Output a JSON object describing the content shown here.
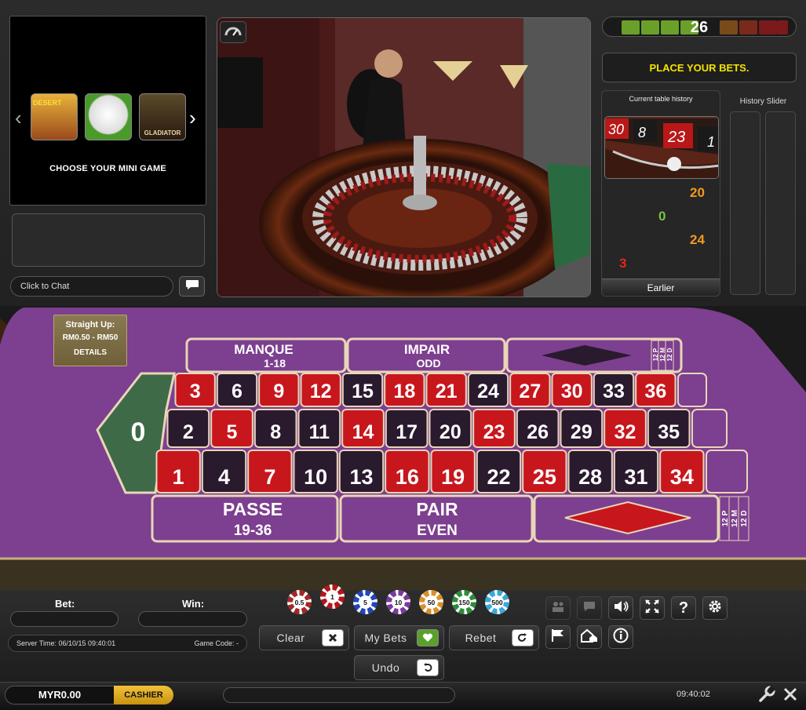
{
  "mini_game": {
    "caption": "CHOOSE YOUR MINI GAME",
    "thumbs": [
      {
        "name": "desert-treasure-thumb",
        "label": "DESERT"
      },
      {
        "name": "football-thumb",
        "label": ""
      },
      {
        "name": "gladiator-thumb",
        "label": "GLADIATOR"
      }
    ]
  },
  "chat": {
    "placeholder": "Click to Chat"
  },
  "timer": {
    "value": "26"
  },
  "status": {
    "message": "PLACE YOUR BETS."
  },
  "history": {
    "title": "Current table history",
    "wheel_numbers": [
      "30",
      "8",
      "23",
      "1"
    ],
    "results": [
      {
        "value": "20",
        "color": "#f39a1e"
      },
      {
        "value": "0",
        "color": "#7bc142"
      },
      {
        "value": "24",
        "color": "#f39a1e"
      },
      {
        "value": "3",
        "color": "#e8261a"
      }
    ],
    "earlier_label": "Earlier"
  },
  "slider": {
    "title": "History Slider"
  },
  "limits": {
    "title": "Straight Up:",
    "range": "RM0.50 - RM50",
    "details": "DETAILS"
  },
  "table": {
    "zero": "0",
    "manque": "MANQUE",
    "manque_range": "1-18",
    "impair": "IMPAIR",
    "impair_en": "ODD",
    "passe": "PASSE",
    "passe_range": "19-36",
    "pair": "PAIR",
    "pair_en": "EVEN",
    "dozen_top": [
      "12 P",
      "12 M",
      "12 D"
    ],
    "dozen_bottom": [
      "12 P",
      "12 M",
      "12 D"
    ],
    "colors": {
      "felt": "#7d3f8f",
      "red": "#c8161d",
      "black": "#2a1a2e",
      "green": "#3e6a48"
    },
    "rows": [
      [
        {
          "n": "3",
          "c": "red"
        },
        {
          "n": "6",
          "c": "black"
        },
        {
          "n": "9",
          "c": "red"
        },
        {
          "n": "12",
          "c": "red"
        },
        {
          "n": "15",
          "c": "black"
        },
        {
          "n": "18",
          "c": "red"
        },
        {
          "n": "21",
          "c": "red"
        },
        {
          "n": "24",
          "c": "black"
        },
        {
          "n": "27",
          "c": "red"
        },
        {
          "n": "30",
          "c": "red"
        },
        {
          "n": "33",
          "c": "black"
        },
        {
          "n": "36",
          "c": "red"
        }
      ],
      [
        {
          "n": "2",
          "c": "black"
        },
        {
          "n": "5",
          "c": "red"
        },
        {
          "n": "8",
          "c": "black"
        },
        {
          "n": "11",
          "c": "black"
        },
        {
          "n": "14",
          "c": "red"
        },
        {
          "n": "17",
          "c": "black"
        },
        {
          "n": "20",
          "c": "black"
        },
        {
          "n": "23",
          "c": "red"
        },
        {
          "n": "26",
          "c": "black"
        },
        {
          "n": "29",
          "c": "black"
        },
        {
          "n": "32",
          "c": "red"
        },
        {
          "n": "35",
          "c": "black"
        }
      ],
      [
        {
          "n": "1",
          "c": "red"
        },
        {
          "n": "4",
          "c": "black"
        },
        {
          "n": "7",
          "c": "red"
        },
        {
          "n": "10",
          "c": "black"
        },
        {
          "n": "13",
          "c": "black"
        },
        {
          "n": "16",
          "c": "red"
        },
        {
          "n": "19",
          "c": "red"
        },
        {
          "n": "22",
          "c": "black"
        },
        {
          "n": "25",
          "c": "red"
        },
        {
          "n": "28",
          "c": "black"
        },
        {
          "n": "31",
          "c": "black"
        },
        {
          "n": "34",
          "c": "red"
        }
      ]
    ]
  },
  "bets": {
    "bet_label": "Bet:",
    "win_label": "Win:",
    "server_time": "Server Time: 06/10/15 09:40:01",
    "game_code": "Game Code: -"
  },
  "chips": [
    {
      "value": "0.5",
      "color": "#a02a2a"
    },
    {
      "value": "1",
      "color": "#b3161d"
    },
    {
      "value": "5",
      "color": "#2346b8"
    },
    {
      "value": "10",
      "color": "#7a3aa0"
    },
    {
      "value": "50",
      "color": "#d9902a"
    },
    {
      "value": "150",
      "color": "#2e8b3a"
    },
    {
      "value": "500",
      "color": "#3aa8d8"
    }
  ],
  "controls": {
    "clear": "Clear",
    "my_bets": "My Bets",
    "rebet": "Rebet",
    "undo": "Undo"
  },
  "footer": {
    "balance": "MYR0.00",
    "cashier": "CASHIER",
    "clock": "09:40:02"
  }
}
